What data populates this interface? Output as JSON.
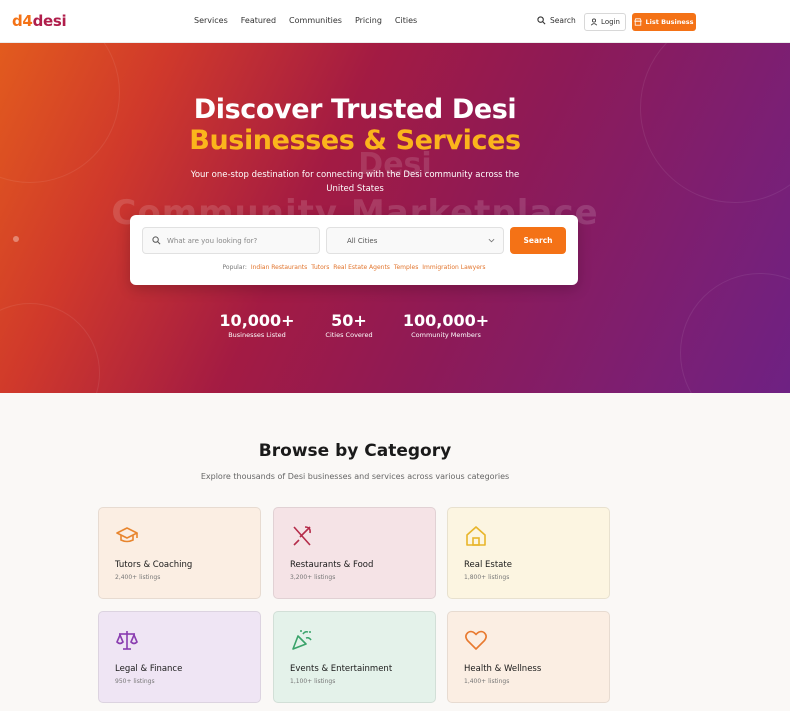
{
  "header": {
    "logo_part1": "d4",
    "logo_part2": "desi",
    "nav": [
      "Services",
      "Featured",
      "Communities",
      "Pricing",
      "Cities"
    ],
    "search_label": "Search",
    "login_label": "Login",
    "list_business_label": "List Business"
  },
  "hero": {
    "watermark_line1": "Desi",
    "watermark_line2": "Community Marketplace",
    "title_line1": "Discover Trusted Desi",
    "title_line2": "Businesses & Services",
    "subtitle": "Your one-stop destination for connecting with the Desi community across the United States",
    "search": {
      "placeholder": "What are you looking for?",
      "city_value": "All Cities",
      "button_label": "Search"
    },
    "popular_label": "Popular:",
    "popular_tags": [
      "Indian Restaurants",
      "Tutors",
      "Real Estate Agents",
      "Temples",
      "Immigration Lawyers"
    ],
    "stats": [
      {
        "value": "10,000+",
        "label": "Businesses Listed"
      },
      {
        "value": "50+",
        "label": "Cities Covered"
      },
      {
        "value": "100,000+",
        "label": "Community Members"
      }
    ]
  },
  "categories": {
    "title": "Browse by Category",
    "subtitle": "Explore thousands of Desi businesses and services across various categories",
    "items": [
      {
        "name": "Tutors & Coaching",
        "count": "2,400+ listings",
        "icon": "graduation-cap-icon",
        "bg": "#fbeee3",
        "color": "#e8852e"
      },
      {
        "name": "Restaurants & Food",
        "count": "3,200+ listings",
        "icon": "utensils-icon",
        "bg": "#f5e3e6",
        "color": "#b52c4a"
      },
      {
        "name": "Real Estate",
        "count": "1,800+ listings",
        "icon": "home-icon",
        "bg": "#fcf5e1",
        "color": "#e8b52a"
      },
      {
        "name": "Legal & Finance",
        "count": "950+ listings",
        "icon": "scale-icon",
        "bg": "#efe5f4",
        "color": "#8a3db0"
      },
      {
        "name": "Events & Entertainment",
        "count": "1,100+ listings",
        "icon": "party-popper-icon",
        "bg": "#e4f2ea",
        "color": "#3aa36a"
      },
      {
        "name": "Health & Wellness",
        "count": "1,400+ listings",
        "icon": "heart-icon",
        "bg": "#fbeee3",
        "color": "#e87a30"
      }
    ]
  },
  "colors": {
    "accent": "#f47216",
    "brand": "#b01e4b",
    "highlight": "#fbb51c"
  }
}
